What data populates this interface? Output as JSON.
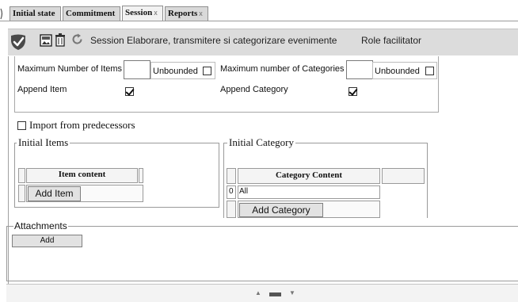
{
  "tabs": [
    {
      "label": "Initial state",
      "closable": false,
      "active": false
    },
    {
      "label": "Commitment",
      "closable": false,
      "active": false
    },
    {
      "label": "Session",
      "closable": true,
      "active": true
    },
    {
      "label": "Reports",
      "closable": true,
      "active": false
    }
  ],
  "tab_close_glyph": "x",
  "toolbar": {
    "session_text": "Session Elaborare, transmitere si categorizare evenimente",
    "role_text": "Role facilitator",
    "icons": [
      "check-shield-icon",
      "image-icon",
      "trash-icon",
      "refresh-icon"
    ]
  },
  "settings": {
    "max_items_label": "Maximum Number of Items",
    "max_items_value": "",
    "max_items_unbounded_label": "Unbounded",
    "max_items_unbounded_checked": false,
    "max_categories_label": "Maximum number of Categories",
    "max_categories_value": "",
    "max_categories_unbounded_label": "Unbounded",
    "max_categories_unbounded_checked": false,
    "append_item_label": "Append Item",
    "append_item_checked": true,
    "append_category_label": "Append Category",
    "append_category_checked": true
  },
  "import": {
    "label": "Import from predecessors",
    "checked": false
  },
  "initial_items": {
    "legend": "Initial Items",
    "column_header": "Item content",
    "rows": [],
    "add_button": "Add Item"
  },
  "initial_category": {
    "legend": "Initial Category",
    "column_header": "Category Content",
    "rows": [
      {
        "index": "0",
        "content": "All"
      }
    ],
    "add_button": "Add Category"
  },
  "attachments": {
    "legend": "Attachments",
    "add_button": "Add"
  },
  "colors": {
    "toolbar_bg": "#dcdcdc",
    "tab_bg": "#d9d9d9",
    "active_tab_bg": "#f2f2f2"
  }
}
